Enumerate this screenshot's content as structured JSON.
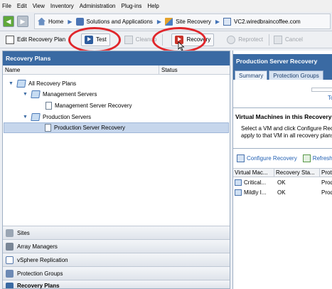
{
  "menu": [
    "File",
    "Edit",
    "View",
    "Inventory",
    "Administration",
    "Plug-ins",
    "Help"
  ],
  "nav": {
    "breadcrumbs": [
      {
        "label": "Home",
        "icon": "home-icon"
      },
      {
        "label": "Solutions and Applications",
        "icon": "solutions-icon"
      },
      {
        "label": "Site Recovery",
        "icon": "site-recovery-icon"
      },
      {
        "label": "VC2.wiredbraincoffee.com",
        "icon": "vcenter-icon"
      }
    ]
  },
  "toolbar": {
    "edit_label": "Edit Recovery Plan",
    "test_label": "Test",
    "cleanup_label": "Cleanup",
    "recovery_label": "Recovery",
    "reprotect_label": "Reprotect",
    "cancel_label": "Cancel"
  },
  "left": {
    "title": "Recovery Plans",
    "col_name": "Name",
    "col_status": "Status",
    "tree": {
      "root": "All Recovery Plans",
      "mgmt_folder": "Management Servers",
      "mgmt_plan": "Management Server Recovery",
      "prod_folder": "Production Servers",
      "prod_plan": "Production Server Recovery"
    },
    "sections": [
      "Sites",
      "Array Managers",
      "vSphere Replication",
      "Protection Groups",
      "Recovery Plans"
    ]
  },
  "right": {
    "title": "Production Server Recovery",
    "tabs": [
      "Summary",
      "Protection Groups"
    ],
    "link_to": "To",
    "vm_title": "Virtual Machines in this Recovery Plan",
    "vm_desc_1": "Select a VM and click Configure Recovery to",
    "vm_desc_2": "apply to that VM in all recovery plans.",
    "configure_label": "Configure Recovery",
    "refresh_label": "Refresh",
    "columns": [
      "Virtual Mac...",
      "Recovery Sta...",
      "Prot..."
    ],
    "rows": [
      {
        "name": "Critical...",
        "status": "OK",
        "prot": "Prod"
      },
      {
        "name": "Mildly I...",
        "status": "OK",
        "prot": "Prod"
      }
    ]
  },
  "colors": {
    "header_blue": "#3a6aa3",
    "annotation_red": "#e0262b"
  }
}
